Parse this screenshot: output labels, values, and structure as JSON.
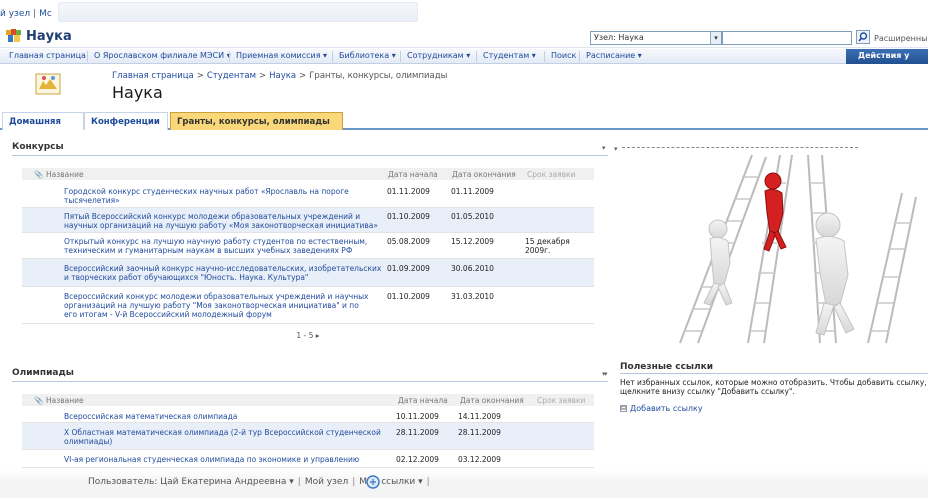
{
  "top_links": {
    "my_site_short": "й узел",
    "my_site2": "Мс"
  },
  "site": {
    "title": "Наука"
  },
  "search": {
    "scope": "Узел: Наука",
    "advanced": "Расширенный"
  },
  "topnav": {
    "items": [
      {
        "label": "Главная страница"
      },
      {
        "label": "О Ярославском филиале МЭСИ ▾"
      },
      {
        "label": "Приемная комиссия ▾"
      },
      {
        "label": "Библиотека ▾"
      },
      {
        "label": "Сотрудникам ▾"
      },
      {
        "label": "Студентам ▾"
      },
      {
        "label": "Поиск"
      },
      {
        "label": "Расписание ▾"
      }
    ],
    "actions": "Действия у"
  },
  "breadcrumb": [
    "Главная страница",
    "Студентам",
    "Наука",
    "Гранты, конкурсы, олимпиады"
  ],
  "page_title": "Наука",
  "tabs": [
    {
      "label": "Домашняя"
    },
    {
      "label": "Конференции"
    },
    {
      "label": "Гранты, конкурсы, олимпиады"
    }
  ],
  "contests": {
    "title": "Конкурсы",
    "menu": "▾",
    "cols": {
      "name": "Название",
      "start": "Дата начала",
      "end": "Дата окончания",
      "deadline": "Срок заявки"
    },
    "rows": [
      {
        "name": "Городской конкурс студенческих научных работ «Ярославль на пороге тысячелетия»",
        "start": "01.11.2009",
        "end": "01.11.2009",
        "deadline": ""
      },
      {
        "name": "Пятый Всероссийский конкурс молодежи образовательных учреждений и научных организаций на лучшую работу «Моя законотворческая инициатива»",
        "start": "01.10.2009",
        "end": "01.05.2010",
        "deadline": ""
      },
      {
        "name": "Открытый конкурс на лучшую научную работу студентов по естественным, техническим и гуманитарным наукам в высших учебных заведениях РФ",
        "start": "05.08.2009",
        "end": "15.12.2009",
        "deadline": "15 декабря 2009г."
      },
      {
        "name": "Всероссийский заочный конкурс научно-исследовательских, изобретательских и творческих работ обучающихся \"Юность. Наука. Культура\"",
        "start": "01.09.2009",
        "end": "30.06.2010",
        "deadline": ""
      },
      {
        "name": "Всероссийский конкурс молодежи образовательных учреждений и научных организаций на лучшую работу \"Моя законотворческая инициатива\" и по его итогам - V-й Всероссийский молодежный форум",
        "start": "01.10.2009",
        "end": "31.03.2010",
        "deadline": ""
      }
    ],
    "pager": "1 - 5 ▸"
  },
  "olympiads": {
    "title": "Олимпиады",
    "menu": "▾",
    "cols": {
      "name": "Название",
      "start": "Дата начала",
      "end": "Дата окончания",
      "deadline": "Срок заявки"
    },
    "rows": [
      {
        "name": "Всероссийская математическая олимпиада",
        "start": "10.11.2009",
        "end": "14.11.2009"
      },
      {
        "name": "X Областная математическая олимпиада (2-й тур Всероссийской студенческой олимпиады)",
        "start": "28.11.2009",
        "end": "28.11.2009"
      },
      {
        "name": "VI-ая региональная студенческая олимпиада по экономике и управлению",
        "start": "02.12.2009",
        "end": "03.12.2009"
      }
    ]
  },
  "right_menu": "▾",
  "useful_links": {
    "title": "Полезные ссылки",
    "menu": "▾",
    "empty_text": "Нет избранных ссылок, которые можно отобразить. Чтобы добавить ссылку, щелкните внизу ссылку \"Добавить ссылку\".",
    "add_box": "⊟",
    "add_label": "Добавить ссылку"
  },
  "footer": {
    "user": "Пользователь: Цай Екатерина Андреевна ▾",
    "my_site": "Мой узел",
    "my_links": "Мои ссылки ▾",
    "sep": "|"
  },
  "colors": {
    "accent": "#1f4a9c",
    "tab_selected": "#fad879",
    "actions": "#21508f"
  }
}
